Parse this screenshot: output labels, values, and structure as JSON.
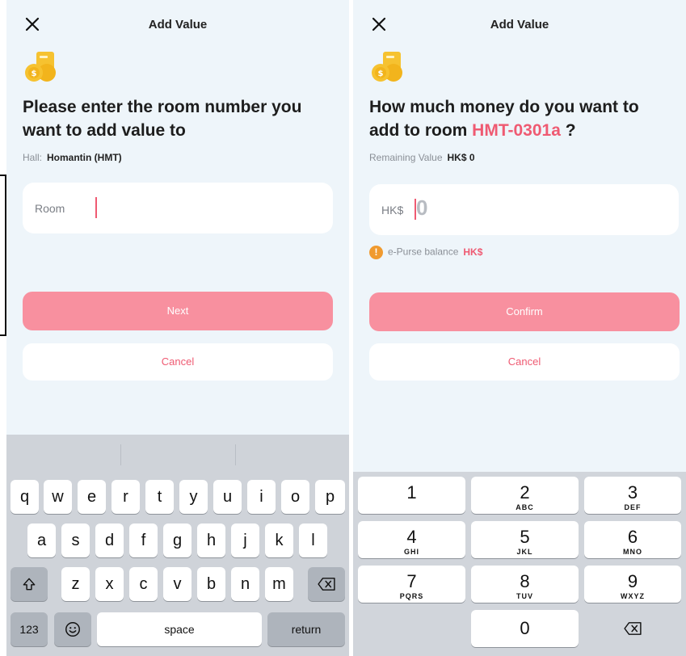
{
  "left": {
    "title": "Add Value",
    "headline": "Please enter the room number you want to add value to",
    "hall_label": "Hall:",
    "hall_value": "Homantin (HMT)",
    "room_label": "Room",
    "next_label": "Next",
    "cancel_label": "Cancel",
    "keyboard": {
      "row1": [
        "q",
        "w",
        "e",
        "r",
        "t",
        "y",
        "u",
        "i",
        "o",
        "p"
      ],
      "row2": [
        "a",
        "s",
        "d",
        "f",
        "g",
        "h",
        "j",
        "k",
        "l"
      ],
      "row3": [
        "z",
        "x",
        "c",
        "v",
        "b",
        "n",
        "m"
      ],
      "numbers_key": "123",
      "space_key": "space",
      "return_key": "return"
    }
  },
  "right": {
    "title": "Add Value",
    "headline_prefix": "How much money do you want to add to room",
    "room_code": "HMT-0301a",
    "headline_suffix": "?",
    "remaining_label": "Remaining Value",
    "remaining_value": "HK$ 0",
    "currency_label": "HK$",
    "amount_value": "0",
    "epurse_label": "e-Purse balance",
    "epurse_value": "HK$",
    "warning_symbol": "!",
    "confirm_label": "Confirm",
    "cancel_label": "Cancel",
    "keypad": [
      {
        "num": "1",
        "letters": ""
      },
      {
        "num": "2",
        "letters": "ABC"
      },
      {
        "num": "3",
        "letters": "DEF"
      },
      {
        "num": "4",
        "letters": "GHI"
      },
      {
        "num": "5",
        "letters": "JKL"
      },
      {
        "num": "6",
        "letters": "MNO"
      },
      {
        "num": "7",
        "letters": "PQRS"
      },
      {
        "num": "8",
        "letters": "TUV"
      },
      {
        "num": "9",
        "letters": "WXYZ"
      },
      {
        "num": "0",
        "letters": ""
      }
    ]
  },
  "icons": {
    "close": "close-icon",
    "coin": "coin-stack-icon",
    "shift": "shift-icon",
    "emoji": "emoji-icon",
    "delete": "backspace-icon"
  },
  "colors": {
    "accent": "#ef5a72",
    "primary_button": "#f8909f",
    "warning": "#f09a2f",
    "panel_bg": "#eef5fa"
  }
}
